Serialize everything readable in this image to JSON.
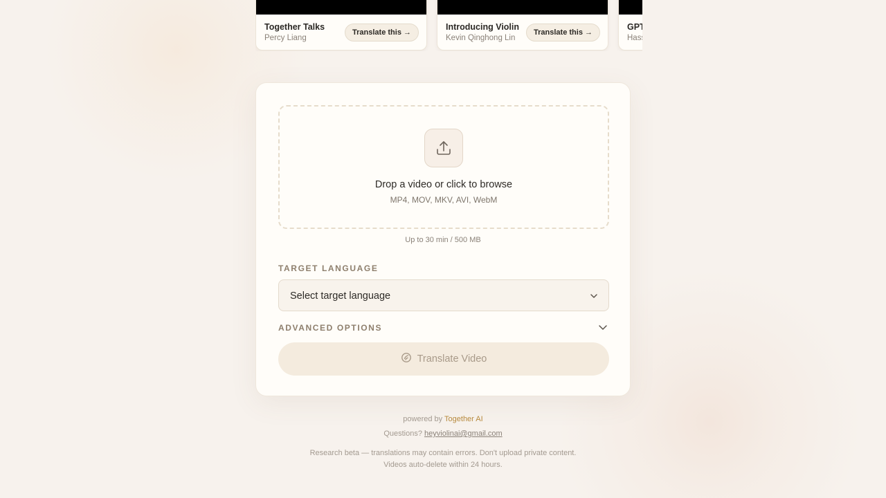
{
  "gallery": {
    "cards": [
      {
        "title": "Together Talks",
        "author": "Percy Liang",
        "cta": "Translate this →"
      },
      {
        "title": "Introducing Violin",
        "author": "Kevin Qinghong Lin",
        "cta": "Translate this →"
      },
      {
        "title": "GPT",
        "author": "Hass"
      }
    ]
  },
  "upload": {
    "title": "Drop a video or click to browse",
    "formats": "MP4, MOV, MKV, AVI, WebM",
    "limit": "Up to 30 min / 500 MB",
    "icon": "upload-icon"
  },
  "language": {
    "label": "TARGET LANGUAGE",
    "placeholder": "Select target language"
  },
  "advanced": {
    "label": "ADVANCED OPTIONS"
  },
  "action": {
    "label": "Translate Video",
    "enabled": false
  },
  "footer": {
    "powered_prefix": "powered by",
    "powered_brand": "Together AI",
    "questions_prefix": "Questions?",
    "email": "heyviolinai@gmail.com",
    "disclaimer_line1": "Research beta — translations may contain errors. Don't upload private content.",
    "disclaimer_line2": "Videos auto-delete within 24 hours."
  },
  "colors": {
    "background": "#f7f2ed",
    "card": "#fffdf9",
    "accent": "#b78a3e",
    "button_disabled": "#f4ebde"
  }
}
